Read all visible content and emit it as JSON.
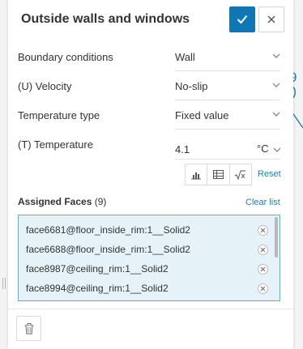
{
  "panel": {
    "title": "Outside walls and windows"
  },
  "fields": [
    {
      "label": "Boundary conditions",
      "value": "Wall"
    },
    {
      "label": "(U) Velocity",
      "value": "No-slip"
    },
    {
      "label": "Temperature type",
      "value": "Fixed value"
    },
    {
      "label": "(T) Temperature",
      "value": "4.1",
      "unit": "°C"
    }
  ],
  "tools": {
    "reset_label": "Reset",
    "icons": [
      "chart-icon",
      "table-icon",
      "formula-icon"
    ]
  },
  "assigned": {
    "label": "Assigned Faces",
    "count": "(9)",
    "clear_label": "Clear list",
    "faces": [
      "face6681@floor_inside_rim:1__Solid2",
      "face6688@floor_inside_rim:1__Solid2",
      "face8987@ceiling_rim:1__Solid2",
      "face8994@ceiling_rim:1__Solid2"
    ]
  },
  "background": {
    "visible_number": "9"
  },
  "colors": {
    "accent": "#0f78b4",
    "link": "#1f7fae",
    "selection_bg": "#e5f3f9",
    "selection_border": "#4fb1d3"
  }
}
